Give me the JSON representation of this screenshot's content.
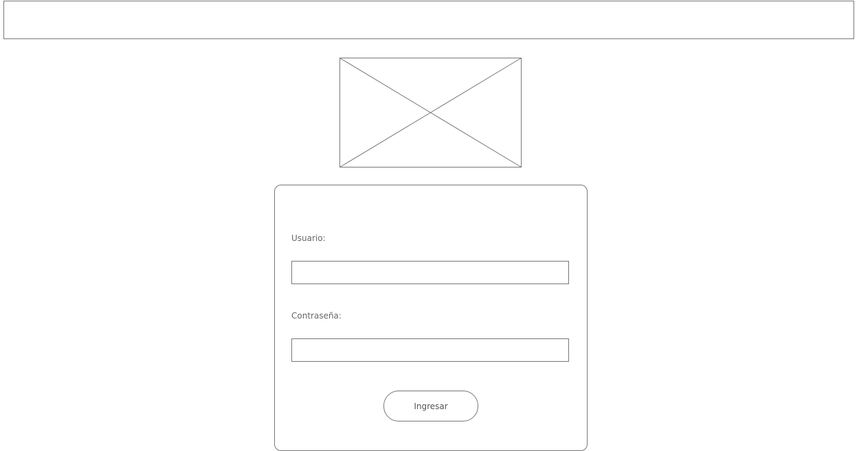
{
  "header": {
    "bar_label": ""
  },
  "logo": {
    "icon": "image-placeholder-icon"
  },
  "login_form": {
    "username_label": "Usuario:",
    "username_value": "",
    "username_placeholder": "",
    "password_label": "Contraseña:",
    "password_value": "",
    "password_placeholder": "",
    "submit_label": "Ingresar"
  },
  "colors": {
    "border": "#777777",
    "background": "#ffffff",
    "text": "#666666"
  }
}
